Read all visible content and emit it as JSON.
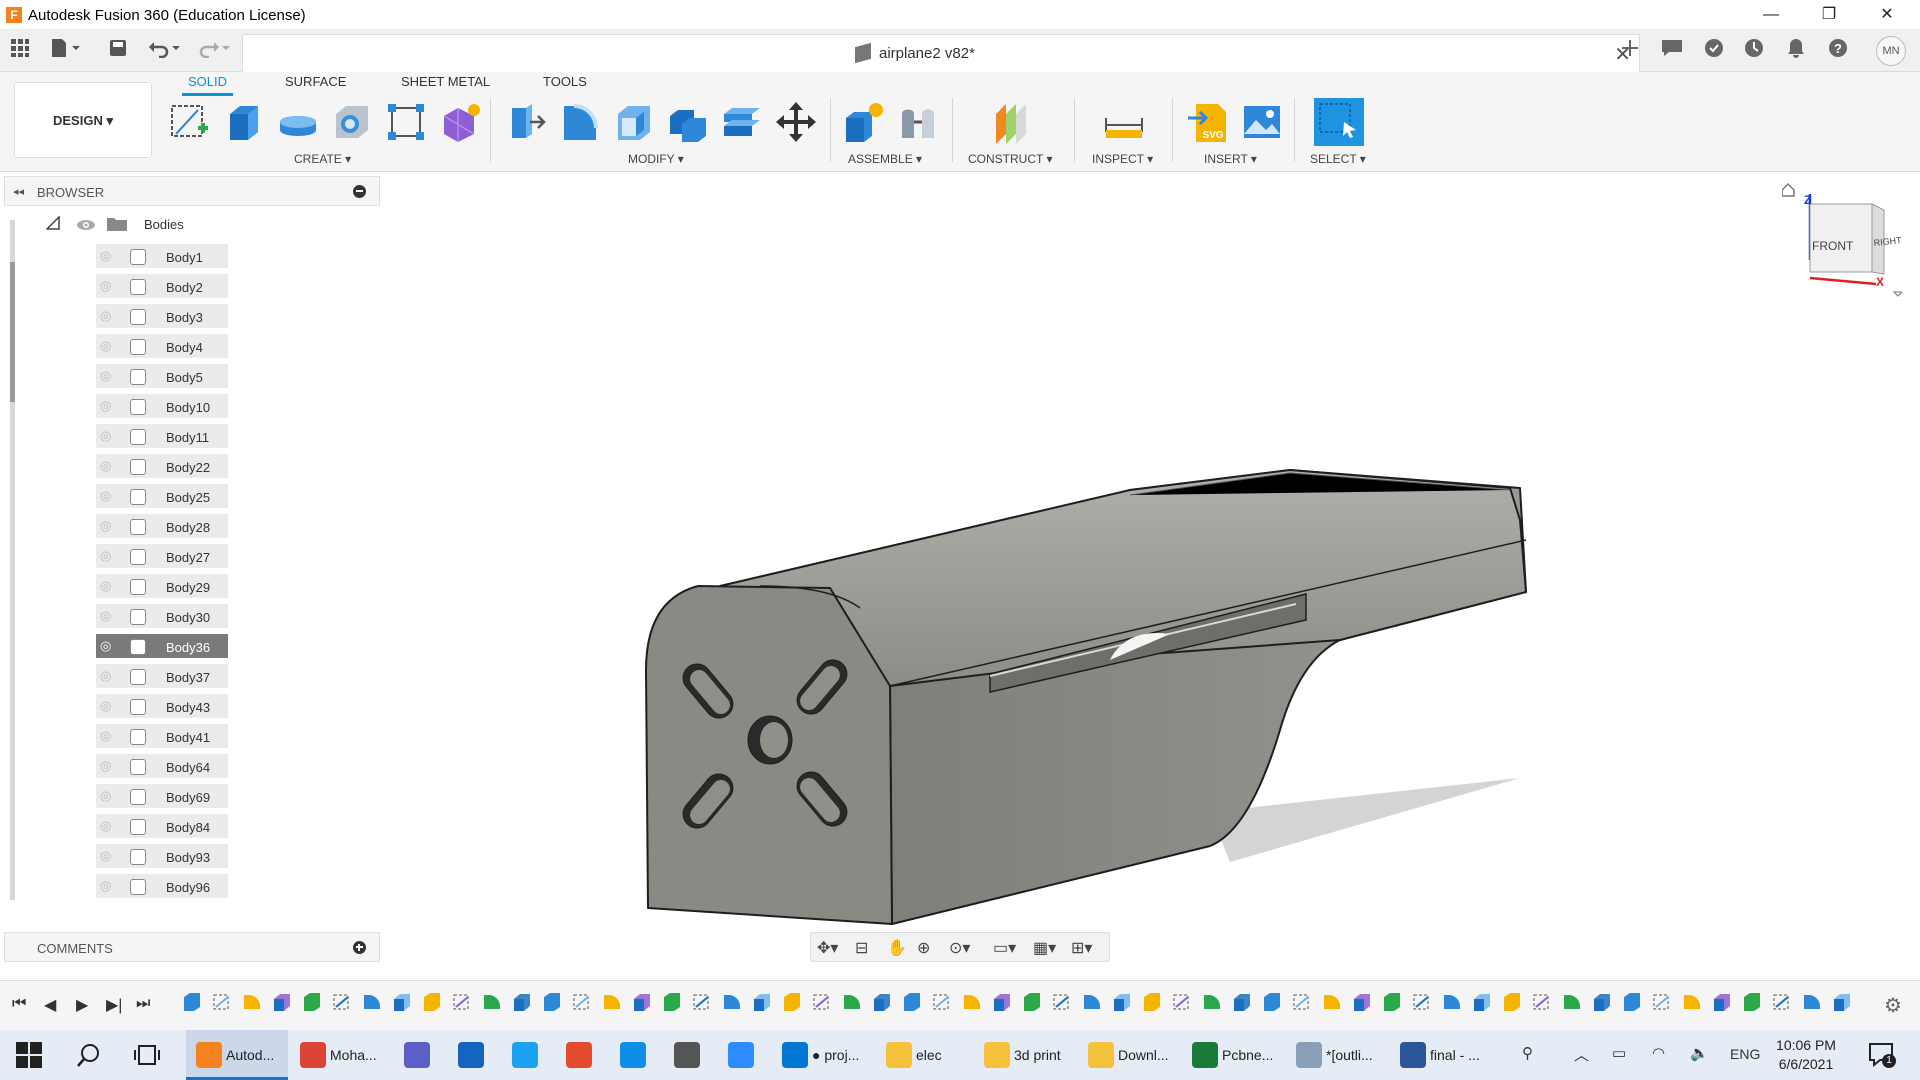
{
  "window": {
    "title": "Autodesk Fusion 360 (Education License)",
    "app_icon_letter": "F",
    "minimize": "—",
    "maximize": "❐",
    "close": "✕"
  },
  "document": {
    "name": "airplane2 v82*",
    "close": "✕"
  },
  "workspace": {
    "label": "DESIGN ▾"
  },
  "ribbon": {
    "tabs": [
      "SOLID",
      "SURFACE",
      "SHEET METAL",
      "TOOLS"
    ],
    "active_tab": "SOLID",
    "groups": [
      "CREATE ▾",
      "MODIFY ▾",
      "ASSEMBLE ▾",
      "CONSTRUCT ▾",
      "INSPECT ▾",
      "INSERT ▾",
      "SELECT ▾"
    ]
  },
  "browser": {
    "title": "BROWSER",
    "folder": "Bodies",
    "bodies": [
      "Body1",
      "Body2",
      "Body3",
      "Body4",
      "Body5",
      "Body10",
      "Body11",
      "Body22",
      "Body25",
      "Body28",
      "Body27",
      "Body29",
      "Body30",
      "Body36",
      "Body37",
      "Body43",
      "Body41",
      "Body64",
      "Body69",
      "Body84",
      "Body93",
      "Body96"
    ],
    "visible_body": "Body36"
  },
  "comments": {
    "title": "COMMENTS"
  },
  "viewcube": {
    "front": "FRONT",
    "right": "RIGHT",
    "z": "Z",
    "x": "X"
  },
  "taskbar": {
    "apps": [
      {
        "label": "Autod...",
        "icon": "fusion-icon",
        "color": "#f5821f"
      },
      {
        "label": "Moha...",
        "icon": "chrome-icon",
        "color": "#db4437"
      },
      {
        "label": "",
        "icon": "teams-icon",
        "color": "#5b5fc7"
      },
      {
        "label": "",
        "icon": "app-icon",
        "color": "#1565c0"
      },
      {
        "label": "",
        "icon": "ie-icon",
        "color": "#1ea1f1"
      },
      {
        "label": "",
        "icon": "git-icon",
        "color": "#e44c30"
      },
      {
        "label": "",
        "icon": "teamviewer-icon",
        "color": "#0e8ee9"
      },
      {
        "label": "",
        "icon": "airplane-app-icon",
        "color": "#555555"
      },
      {
        "label": "",
        "icon": "zoom-icon",
        "color": "#2d8cff"
      },
      {
        "label": "● proj...",
        "icon": "vscode-icon",
        "color": "#0078d4"
      },
      {
        "label": "elec",
        "icon": "folder-icon",
        "color": "#f3c13a"
      },
      {
        "label": "3d print",
        "icon": "folder-icon",
        "color": "#f3c13a"
      },
      {
        "label": "Downl...",
        "icon": "folder-icon",
        "color": "#f3c13a"
      },
      {
        "label": "Pcbne...",
        "icon": "pcb-icon",
        "color": "#1a7a3a"
      },
      {
        "label": "*[outli...",
        "icon": "notepad-icon",
        "color": "#8aa0b8"
      },
      {
        "label": "final - ...",
        "icon": "word-icon",
        "color": "#2b579a"
      }
    ],
    "tray": {
      "lang": "ENG",
      "time": "10:06 PM",
      "date": "6/6/2021",
      "notifications": "1"
    }
  },
  "colors": {
    "accent": "#0696d7",
    "model": "#8c8b86",
    "selected": "#7a7a7a"
  }
}
